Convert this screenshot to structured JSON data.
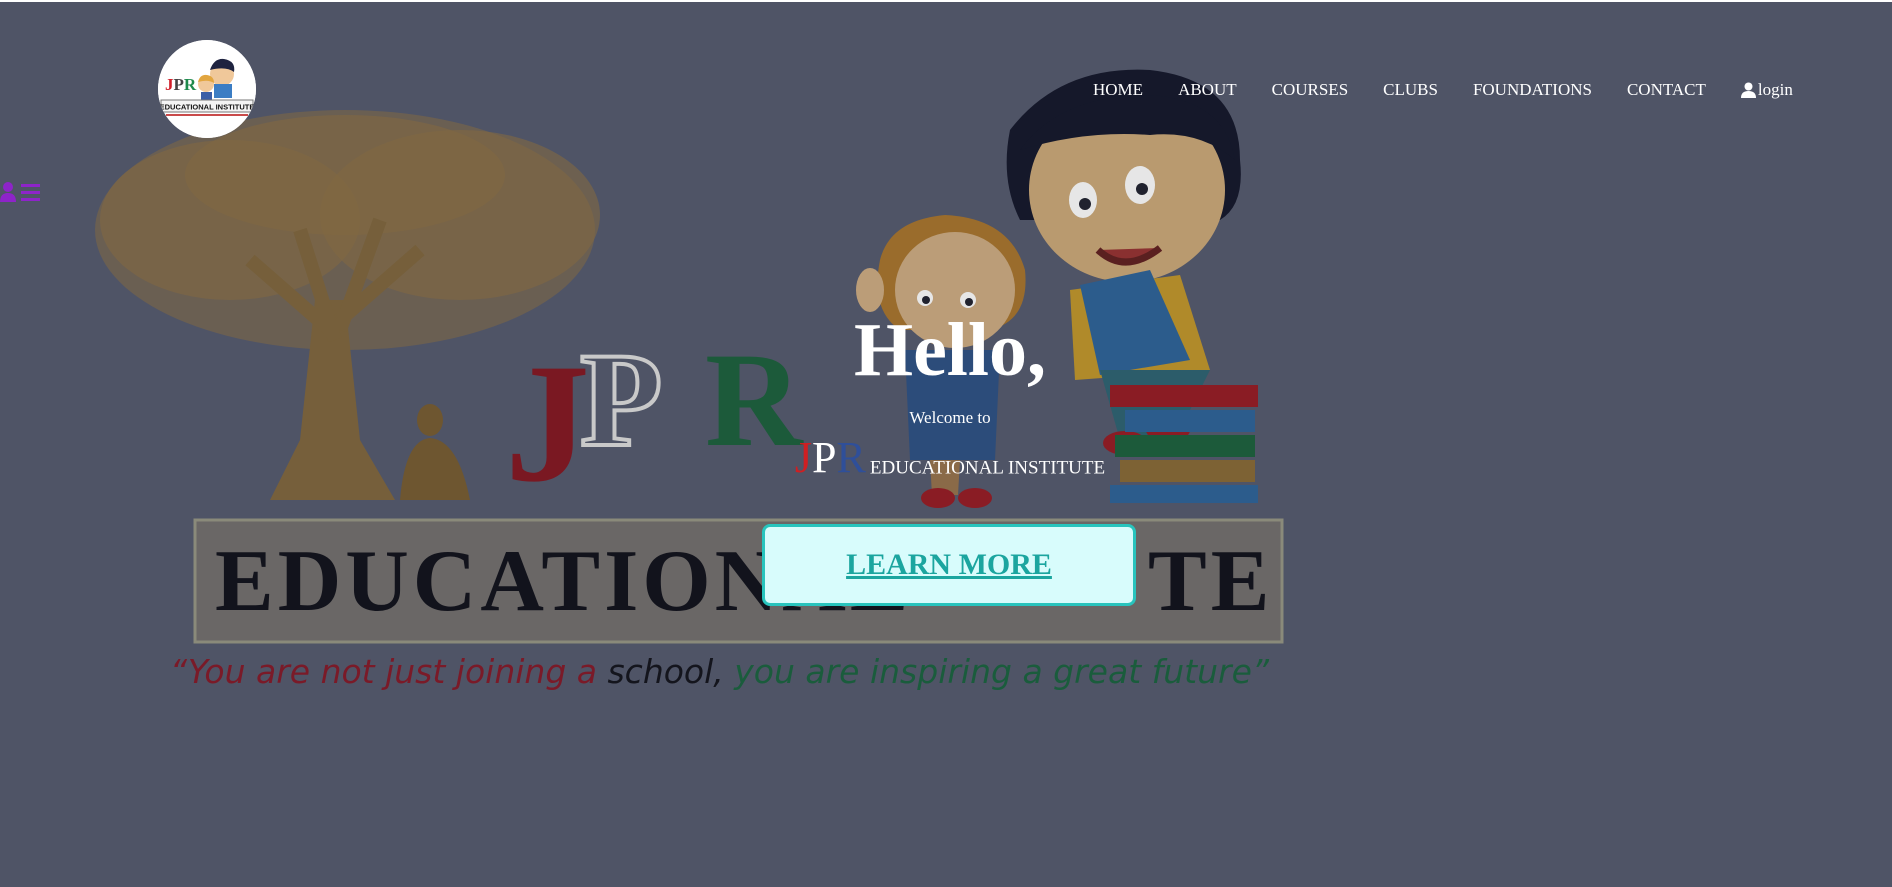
{
  "logo": {
    "line1": "JPR",
    "line2": "EDUCATIONAL INSTITUTE"
  },
  "nav": {
    "home": "HOME",
    "about": "ABOUT",
    "courses": "COURSES",
    "clubs": "CLUBS",
    "foundations": "FOUNDATIONS",
    "contact": "CONTACT",
    "login": "login"
  },
  "hero": {
    "greeting": "Hello,",
    "welcome": "Welcome to",
    "brand_j": "J",
    "brand_p": "P",
    "brand_r": "R",
    "brand_rest": "EDUCATIONAL INSTITUTE",
    "cta": "LEARN MORE"
  },
  "background_art": {
    "title": "JPR",
    "banner": "EDUCATIONAL INSTITUTE",
    "banner_visible": "EDUCATIONAL   TE",
    "tagline_a": "“You are not just joining a ",
    "tagline_b": "school, ",
    "tagline_c": "you are inspiring a great future”"
  },
  "colors": {
    "overlay": "#4f5466",
    "j_red": "#cf1f22",
    "p_white": "#ffffff",
    "r_blue": "#2f4f99",
    "cta_bg": "#d8fcfc",
    "cta_text": "#1ba59f",
    "menu_icon": "#8e24c9"
  },
  "icons": {
    "side_menu": "user-list-icon",
    "login": "user-icon"
  }
}
